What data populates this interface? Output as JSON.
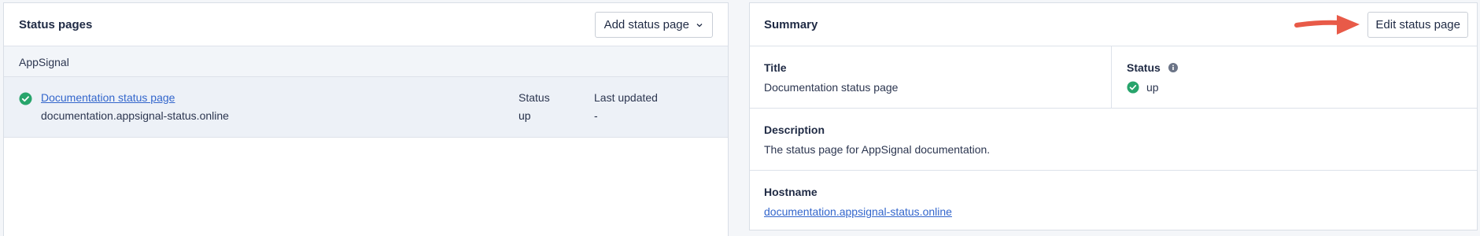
{
  "left": {
    "title": "Status pages",
    "add_button_label": "Add status page",
    "group_label": "AppSignal",
    "rows": [
      {
        "name": "Documentation status page",
        "hostname": "documentation.appsignal-status.online",
        "status_header": "Status",
        "status_value": "up",
        "updated_header": "Last updated",
        "updated_value": "-"
      }
    ]
  },
  "right": {
    "title": "Summary",
    "edit_button_label": "Edit status page",
    "title_label": "Title",
    "title_value": "Documentation status page",
    "status_label": "Status",
    "status_value": "up",
    "description_label": "Description",
    "description_value": "The status page for AppSignal documentation.",
    "hostname_label": "Hostname",
    "hostname_value": "documentation.appsignal-status.online"
  },
  "colors": {
    "status_ok": "#27a46b",
    "link": "#3366cc",
    "arrow": "#e85a48"
  },
  "icons": [
    "check-circle-icon",
    "chevron-down-icon",
    "info-icon",
    "arrow-pointer-icon"
  ]
}
